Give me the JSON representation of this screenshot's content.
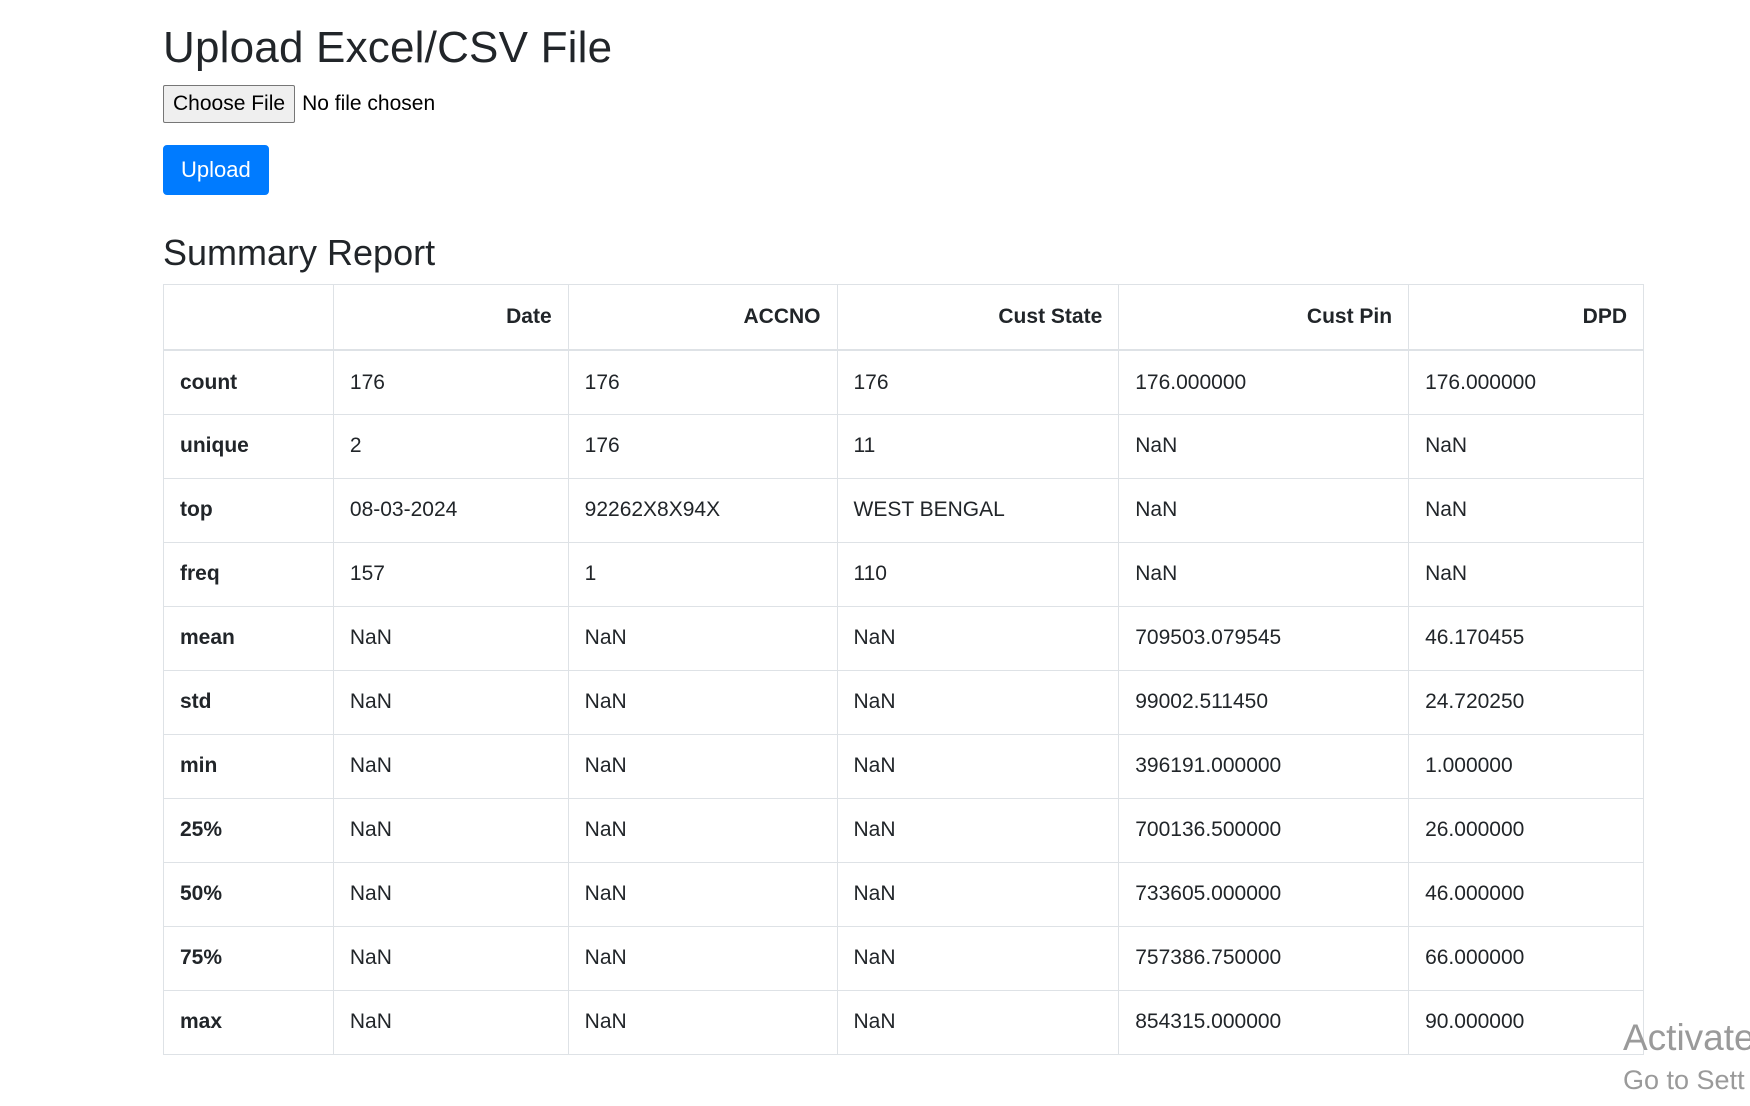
{
  "upload": {
    "title": "Upload Excel/CSV File",
    "choose_file_label": "Choose File",
    "file_status": "No file chosen",
    "upload_label": "Upload"
  },
  "summary": {
    "title": "Summary Report",
    "columns": [
      "",
      "Date",
      "ACCNO",
      "Cust State",
      "Cust Pin",
      "DPD"
    ],
    "rows": [
      {
        "label": "count",
        "values": [
          "176",
          "176",
          "176",
          "176.000000",
          "176.000000"
        ]
      },
      {
        "label": "unique",
        "values": [
          "2",
          "176",
          "11",
          "NaN",
          "NaN"
        ]
      },
      {
        "label": "top",
        "values": [
          "08-03-2024",
          "92262X8X94X",
          "WEST BENGAL",
          "NaN",
          "NaN"
        ]
      },
      {
        "label": "freq",
        "values": [
          "157",
          "1",
          "110",
          "NaN",
          "NaN"
        ]
      },
      {
        "label": "mean",
        "values": [
          "NaN",
          "NaN",
          "NaN",
          "709503.079545",
          "46.170455"
        ]
      },
      {
        "label": "std",
        "values": [
          "NaN",
          "NaN",
          "NaN",
          "99002.511450",
          "24.720250"
        ]
      },
      {
        "label": "min",
        "values": [
          "NaN",
          "NaN",
          "NaN",
          "396191.000000",
          "1.000000"
        ]
      },
      {
        "label": "25%",
        "values": [
          "NaN",
          "NaN",
          "NaN",
          "700136.500000",
          "26.000000"
        ]
      },
      {
        "label": "50%",
        "values": [
          "NaN",
          "NaN",
          "NaN",
          "733605.000000",
          "46.000000"
        ]
      },
      {
        "label": "75%",
        "values": [
          "NaN",
          "NaN",
          "NaN",
          "757386.750000",
          "66.000000"
        ]
      },
      {
        "label": "max",
        "values": [
          "NaN",
          "NaN",
          "NaN",
          "854315.000000",
          "90.000000"
        ]
      }
    ]
  },
  "watermark": {
    "title": "Activate",
    "subtitle": "Go to Sett"
  },
  "colors": {
    "primary": "#007bff",
    "text": "#212529",
    "border": "#dee2e6",
    "watermark": "#9a9a9a"
  }
}
